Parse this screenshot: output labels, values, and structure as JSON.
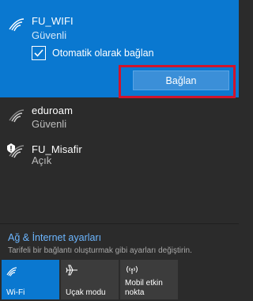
{
  "networks": [
    {
      "name": "FU_WIFI",
      "status": "Güvenli",
      "selected": true,
      "auto_connect_label": "Otomatik olarak bağlan",
      "auto_connect_checked": true,
      "connect_label": "Bağlan"
    },
    {
      "name": "eduroam",
      "status": "Güvenli",
      "selected": false,
      "secured": true
    },
    {
      "name": "FU_Misafir",
      "status": "Açık",
      "selected": false,
      "secured": false
    }
  ],
  "settings": {
    "link_label": "Ağ & İnternet ayarları",
    "description": "Tarifeli bir bağlantı oluşturmak gibi ayarları değiştirin."
  },
  "quick_actions": [
    {
      "label": "Wi-Fi",
      "active": true,
      "icon": "wifi-icon"
    },
    {
      "label": "Uçak modu",
      "active": false,
      "icon": "airplane-icon"
    },
    {
      "label": "Mobil etkin nokta",
      "line1": "Mobil etkin",
      "line2": "nokta",
      "active": false,
      "icon": "hotspot-icon"
    }
  ],
  "colors": {
    "background": "#2b2b2b",
    "accent": "#0a78d0",
    "button": "#3b8fd8",
    "highlight": "#d0142b",
    "link": "#6cb6ff"
  }
}
